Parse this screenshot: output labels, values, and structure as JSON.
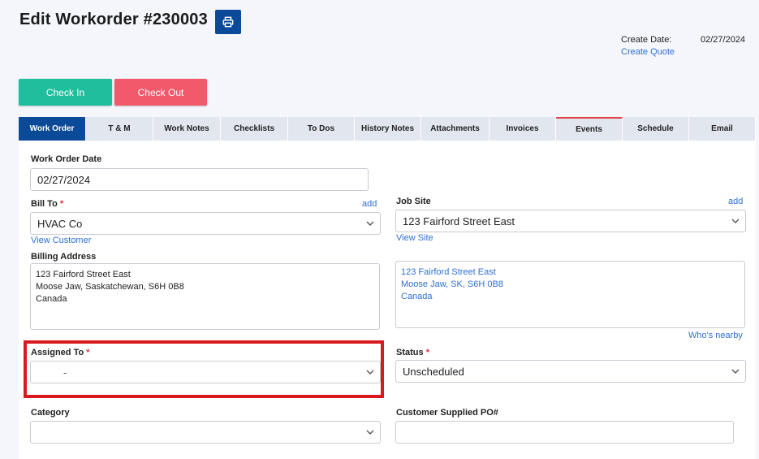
{
  "header": {
    "title": "Edit Workorder #230003",
    "create_date_label": "Create Date:",
    "create_date_value": "02/27/2024",
    "create_quote_link": "Create Quote"
  },
  "actions": {
    "check_in": "Check In",
    "check_out": "Check Out"
  },
  "tabs": [
    {
      "label": "Work Order",
      "active": true
    },
    {
      "label": "T & M"
    },
    {
      "label": "Work Notes"
    },
    {
      "label": "Checklists"
    },
    {
      "label": "To Dos"
    },
    {
      "label": "History Notes"
    },
    {
      "label": "Attachments"
    },
    {
      "label": "Invoices"
    },
    {
      "label": "Events"
    },
    {
      "label": "Schedule"
    },
    {
      "label": "Email"
    }
  ],
  "form": {
    "work_order_date_label": "Work Order Date",
    "work_order_date_value": "02/27/2024",
    "bill_to_label": "Bill To",
    "bill_to_value": "HVAC Co",
    "bill_to_add": "add",
    "view_customer": "View Customer",
    "billing_address_label": "Billing Address",
    "billing_address_lines": [
      "123 Fairford Street East",
      "Moose Jaw, Saskatchewan, S6H 0B8",
      "Canada"
    ],
    "job_site_label": "Job Site",
    "job_site_value": "123 Fairford Street East",
    "job_site_add": "add",
    "view_site": "View Site",
    "job_site_address_lines": [
      "123 Fairford Street East",
      "Moose Jaw, SK, S6H 0B8",
      "Canada"
    ],
    "whos_nearby": "Who's nearby",
    "assigned_to_label": "Assigned To",
    "assigned_to_value": "-",
    "status_label": "Status",
    "status_value": "Unscheduled",
    "category_label": "Category",
    "category_value": "",
    "customer_po_label": "Customer Supplied PO#",
    "customer_po_value": "",
    "required_mark": "*"
  },
  "colors": {
    "primary": "#0b4a99",
    "check_in": "#1fbe9c",
    "check_out": "#f2596b",
    "link": "#2f6fd1",
    "required": "#e0303a",
    "highlight": "#d8191f"
  },
  "icons": {
    "print": "printer-icon",
    "dropdown": "chevron-down-icon"
  }
}
